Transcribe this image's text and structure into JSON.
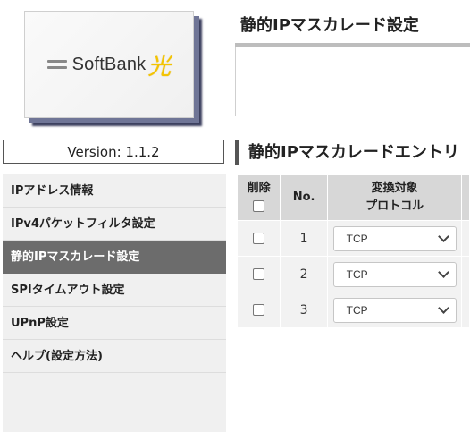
{
  "logo": {
    "brand": "SoftBank",
    "hikari": "光"
  },
  "header": {
    "title": "静的IPマスカレード設定"
  },
  "version": {
    "label": "Version: 1.1.2"
  },
  "sidebar": {
    "items": [
      {
        "label": "IPアドレス情報",
        "active": false
      },
      {
        "label": "IPv4パケットフィルタ設定",
        "active": false
      },
      {
        "label": "静的IPマスカレード設定",
        "active": true
      },
      {
        "label": "SPIタイムアウト設定",
        "active": false
      },
      {
        "label": "UPnP設定",
        "active": false
      },
      {
        "label": "ヘルプ(設定方法)",
        "active": false
      }
    ]
  },
  "section": {
    "title": "静的IPマスカレードエントリ"
  },
  "table": {
    "headers": {
      "delete": "削除",
      "no": "No.",
      "protocol_line1": "変換対象",
      "protocol_line2": "プロトコル"
    },
    "rows": [
      {
        "no": "1",
        "protocol": "TCP"
      },
      {
        "no": "2",
        "protocol": "TCP"
      },
      {
        "no": "3",
        "protocol": "TCP"
      }
    ]
  }
}
